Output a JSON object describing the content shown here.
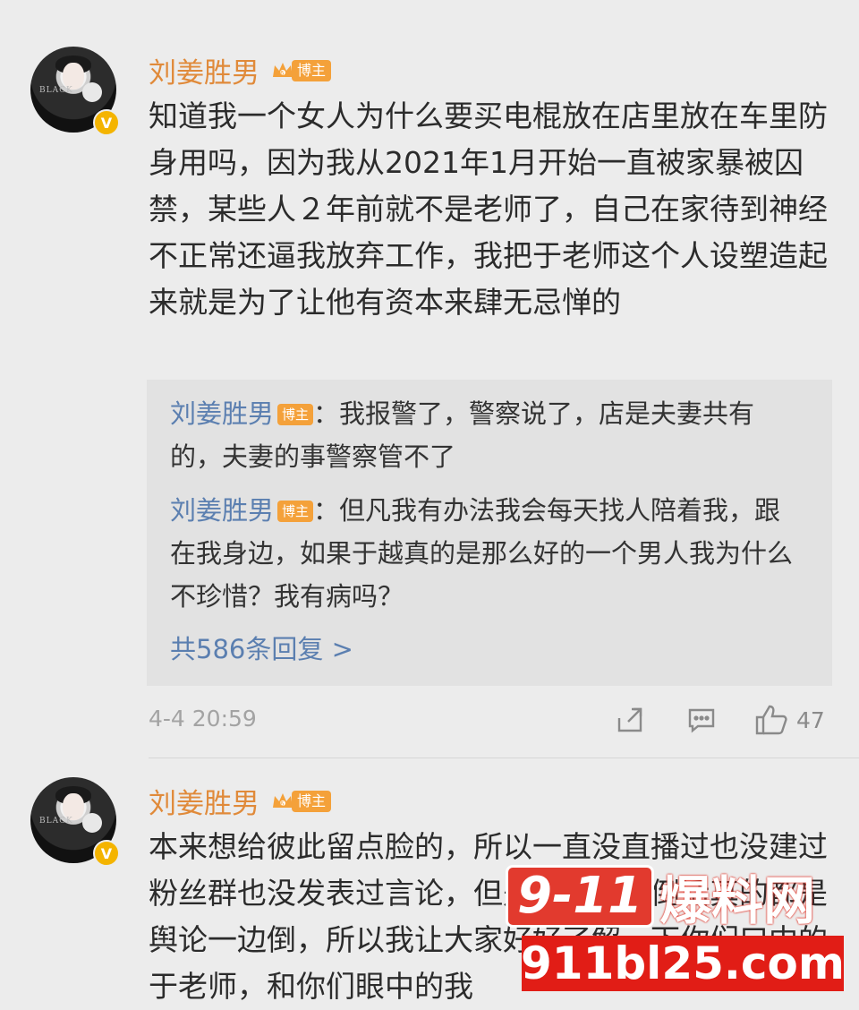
{
  "comments": [
    {
      "username": "刘姜胜男",
      "badge": "博主",
      "text": "知道我一个女人为什么要买电棍放在店里放在车里防身用吗，因为我从2021年1月开始一直被家暴被囚禁，某些人２年前就不是老师了，自己在家待到神经不正常还逼我放弃工作，我把于老师这个人设塑造起来就是为了让他有资本来肆无忌惮的",
      "replies": [
        {
          "name": "刘姜胜男",
          "badge": "博主",
          "sep": "：",
          "text": "我报警了，警察说了，店是夫妻共有的，夫妻的事警察管不了"
        },
        {
          "name": "刘姜胜男",
          "badge": "博主",
          "sep": "：",
          "text": "但凡我有办法我会每天找人陪着我，跟在我身边，如果于越真的是那么好的一个男人我为什么不珍惜？我有病吗？"
        }
      ],
      "more_replies": "共586条回复 >",
      "time": "4-4 20:59",
      "likes": "47"
    },
    {
      "username": "刘姜胜男",
      "badge": "博主",
      "text": "本来想给彼此留点脸的，所以一直没直播过也没建过粉丝群也没发表过言论，但是因为一边倒话真的都是舆论一边倒，所以我让大家好好了解一下你们口中的于老师，和你们眼中的我"
    }
  ],
  "watermark": {
    "badge": "9-11",
    "name": "爆料网",
    "url": "911bl25.com"
  },
  "colors": {
    "username": "#e08a3a",
    "link": "#5b7fb0",
    "badge": "#f4a13a",
    "watermark_red": "#e11d16"
  }
}
